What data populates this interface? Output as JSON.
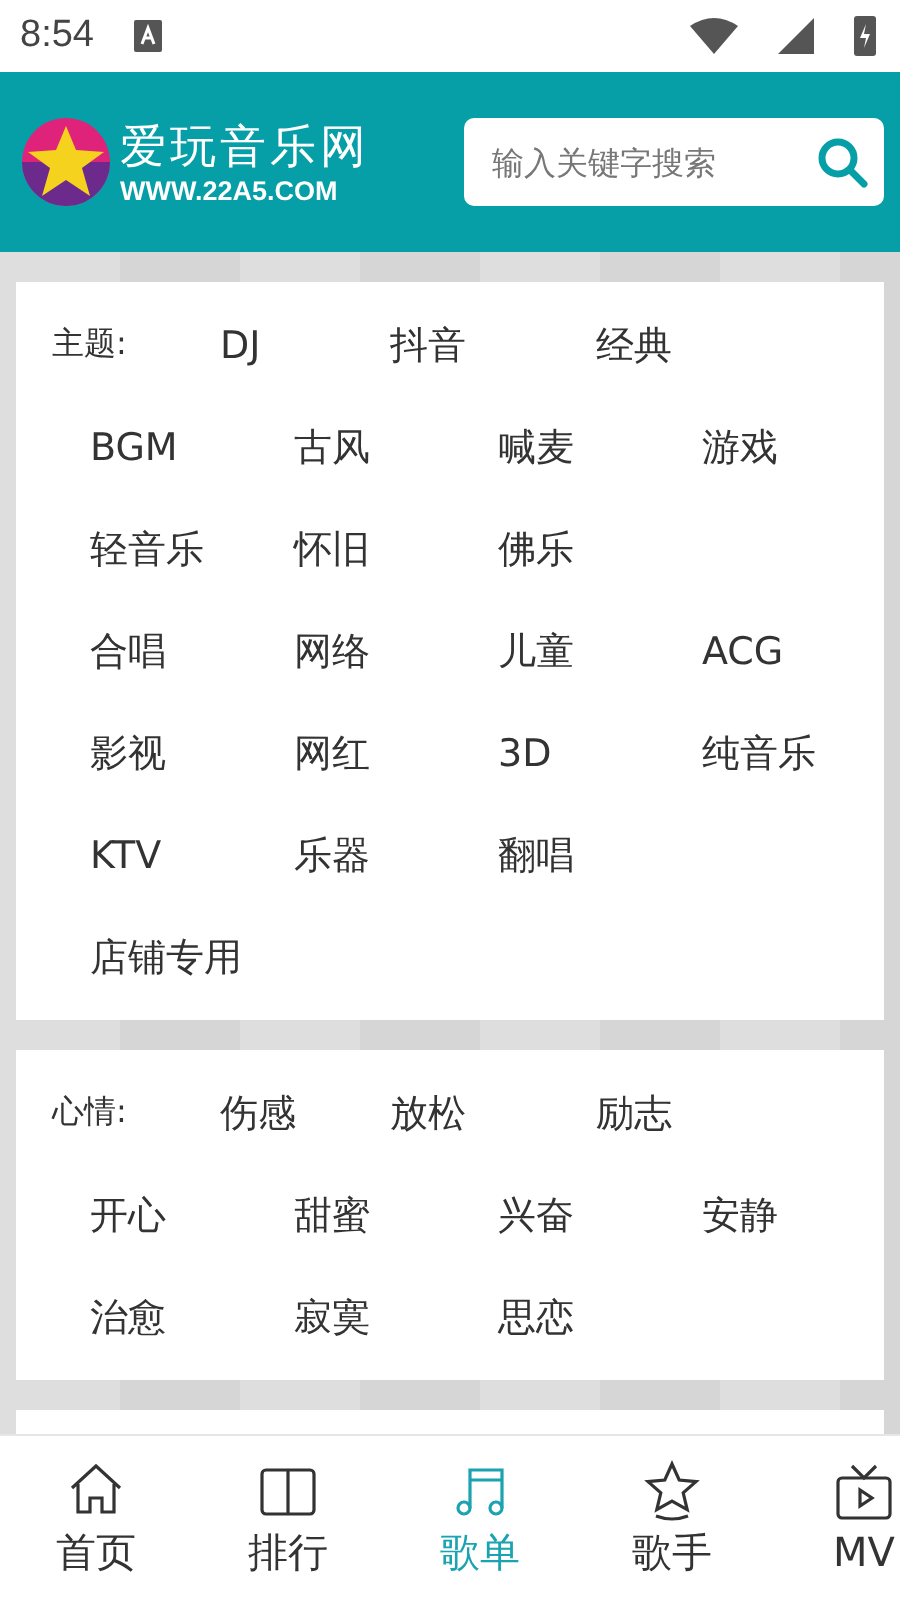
{
  "status_bar": {
    "time": "8:54"
  },
  "header": {
    "logo_title": "爱玩音乐网",
    "logo_url": "WWW.22A5.COM",
    "search": {
      "placeholder": "输入关键字搜索"
    }
  },
  "categories": [
    {
      "label": "主题:",
      "rows": [
        [
          "DJ",
          "抖音",
          "经典"
        ],
        [
          "BGM",
          "古风",
          "喊麦",
          "游戏"
        ],
        [
          "轻音乐",
          "怀旧",
          "佛乐"
        ],
        [
          "合唱",
          "网络",
          "儿童",
          "ACG"
        ],
        [
          "影视",
          "网红",
          "3D",
          "纯音乐"
        ],
        [
          "KTV",
          "乐器",
          "翻唱"
        ],
        [
          "店铺专用"
        ]
      ]
    },
    {
      "label": "心情:",
      "rows": [
        [
          "伤感",
          "放松",
          "励志"
        ],
        [
          "开心",
          "甜蜜",
          "兴奋",
          "安静"
        ],
        [
          "治愈",
          "寂寞",
          "思恋"
        ]
      ]
    }
  ],
  "bottom_nav": [
    {
      "kind": "home",
      "label": "首页",
      "selected": false
    },
    {
      "kind": "book",
      "label": "排行",
      "selected": false
    },
    {
      "kind": "music",
      "label": "歌单",
      "selected": true
    },
    {
      "kind": "star",
      "label": "歌手",
      "selected": false
    },
    {
      "kind": "tv",
      "label": "MV",
      "selected": false
    }
  ]
}
